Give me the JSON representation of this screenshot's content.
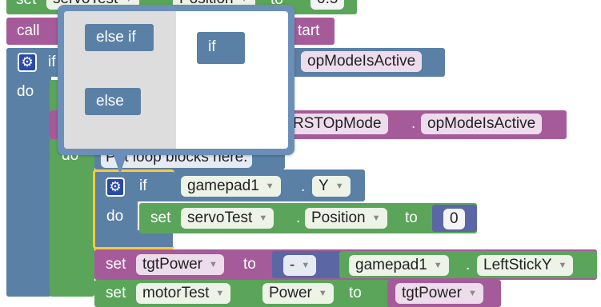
{
  "colors": {
    "control_blue": "#5b80a5",
    "variable_purple": "#a55b99",
    "sensor_green": "#5ba55b",
    "math_slate": "#5b67a5",
    "selection_yellow": "#fcc935",
    "mutator_gray": "#dddddd"
  },
  "blocks": {
    "set_servo_top": {
      "set": "set",
      "variable": "servoTest",
      "property": "Position",
      "to": "to",
      "value": "0.5"
    },
    "call_start": {
      "call": "call",
      "suffix": "tart"
    },
    "if_opmode": {
      "if": "if",
      "do": "do",
      "value": "opModeIsActive"
    },
    "while_opmode": {
      "class": "RSTOpMode",
      "dot": ".",
      "value": "opModeIsActive"
    },
    "comment": "Put loop blocks here.",
    "inner_do": "do",
    "if_gamepad": {
      "if": "if",
      "do": "do",
      "gamepad": "gamepad1",
      "dot": ".",
      "button": "Y"
    },
    "set_servo": {
      "set": "set",
      "variable": "servoTest",
      "dot": ".",
      "property": "Position",
      "to": "to",
      "value": "0"
    },
    "set_power": {
      "set": "set",
      "variable": "tgtPower",
      "to": "to",
      "operator": "-",
      "gamepad": "gamepad1",
      "dot": ".",
      "axis": "LeftStickY"
    },
    "set_motor": {
      "set": "set",
      "variable": "motorTest",
      "property": "Power",
      "to": "to",
      "value": "tgtPower"
    }
  },
  "mutator": {
    "else_if": "else if",
    "else": "else",
    "if": "if"
  }
}
